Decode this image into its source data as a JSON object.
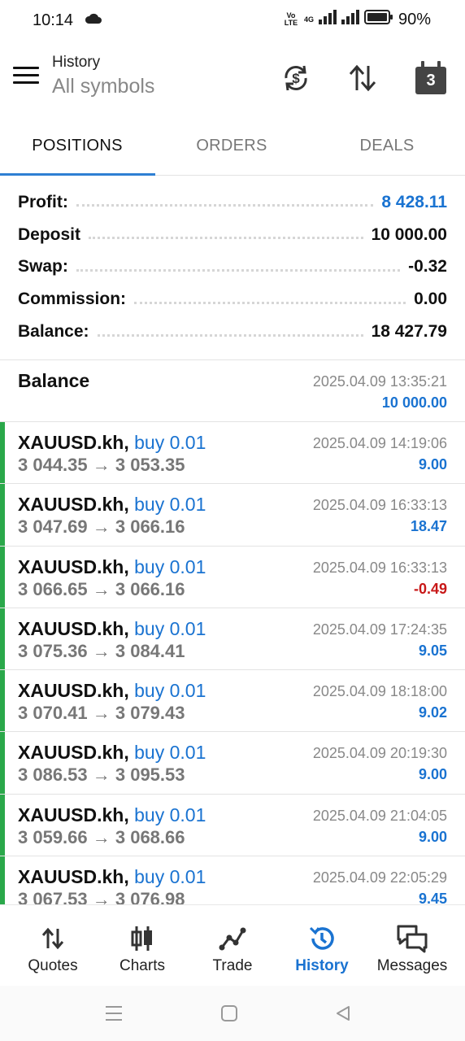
{
  "status_bar": {
    "time": "10:14",
    "volte": "Vo LTE",
    "network": "4G",
    "battery": "90%"
  },
  "header": {
    "title": "History",
    "subtitle": "All symbols",
    "calendar_day": "3"
  },
  "tabs": [
    {
      "label": "POSITIONS",
      "active": true
    },
    {
      "label": "ORDERS",
      "active": false
    },
    {
      "label": "DEALS",
      "active": false
    }
  ],
  "summary": [
    {
      "label": "Profit:",
      "value": "8 428.11",
      "highlight": true
    },
    {
      "label": "Deposit",
      "value": "10 000.00",
      "highlight": false
    },
    {
      "label": "Swap:",
      "value": "-0.32",
      "highlight": false
    },
    {
      "label": "Commission:",
      "value": "0.00",
      "highlight": false
    },
    {
      "label": "Balance:",
      "value": "18 427.79",
      "highlight": false
    }
  ],
  "balance_entry": {
    "label": "Balance",
    "time": "2025.04.09 13:35:21",
    "amount": "10 000.00"
  },
  "deals": [
    {
      "symbol": "XAUUSD.kh,",
      "type": "buy 0.01",
      "price": "3 044.35 → 3 053.35",
      "time": "2025.04.09 14:19:06",
      "profit": "9.00",
      "negative": false
    },
    {
      "symbol": "XAUUSD.kh,",
      "type": "buy 0.01",
      "price": "3 047.69 → 3 066.16",
      "time": "2025.04.09 16:33:13",
      "profit": "18.47",
      "negative": false
    },
    {
      "symbol": "XAUUSD.kh,",
      "type": "buy 0.01",
      "price": "3 066.65 → 3 066.16",
      "time": "2025.04.09 16:33:13",
      "profit": "-0.49",
      "negative": true
    },
    {
      "symbol": "XAUUSD.kh,",
      "type": "buy 0.01",
      "price": "3 075.36 → 3 084.41",
      "time": "2025.04.09 17:24:35",
      "profit": "9.05",
      "negative": false
    },
    {
      "symbol": "XAUUSD.kh,",
      "type": "buy 0.01",
      "price": "3 070.41 → 3 079.43",
      "time": "2025.04.09 18:18:00",
      "profit": "9.02",
      "negative": false
    },
    {
      "symbol": "XAUUSD.kh,",
      "type": "buy 0.01",
      "price": "3 086.53 → 3 095.53",
      "time": "2025.04.09 20:19:30",
      "profit": "9.00",
      "negative": false
    },
    {
      "symbol": "XAUUSD.kh,",
      "type": "buy 0.01",
      "price": "3 059.66 → 3 068.66",
      "time": "2025.04.09 21:04:05",
      "profit": "9.00",
      "negative": false
    },
    {
      "symbol": "XAUUSD.kh,",
      "type": "buy 0.01",
      "price": "3 067.53 → 3 076.98",
      "time": "2025.04.09 22:05:29",
      "profit": "9.45",
      "negative": false
    }
  ],
  "bottom_nav": [
    {
      "label": "Quotes",
      "icon": "quotes-icon",
      "active": false
    },
    {
      "label": "Charts",
      "icon": "charts-icon",
      "active": false
    },
    {
      "label": "Trade",
      "icon": "trade-icon",
      "active": false
    },
    {
      "label": "History",
      "icon": "history-icon",
      "active": true
    },
    {
      "label": "Messages",
      "icon": "messages-icon",
      "active": false
    }
  ],
  "colors": {
    "accent": "#1a73d1",
    "negative": "#c81818",
    "buy_bar": "#2aa84a"
  }
}
